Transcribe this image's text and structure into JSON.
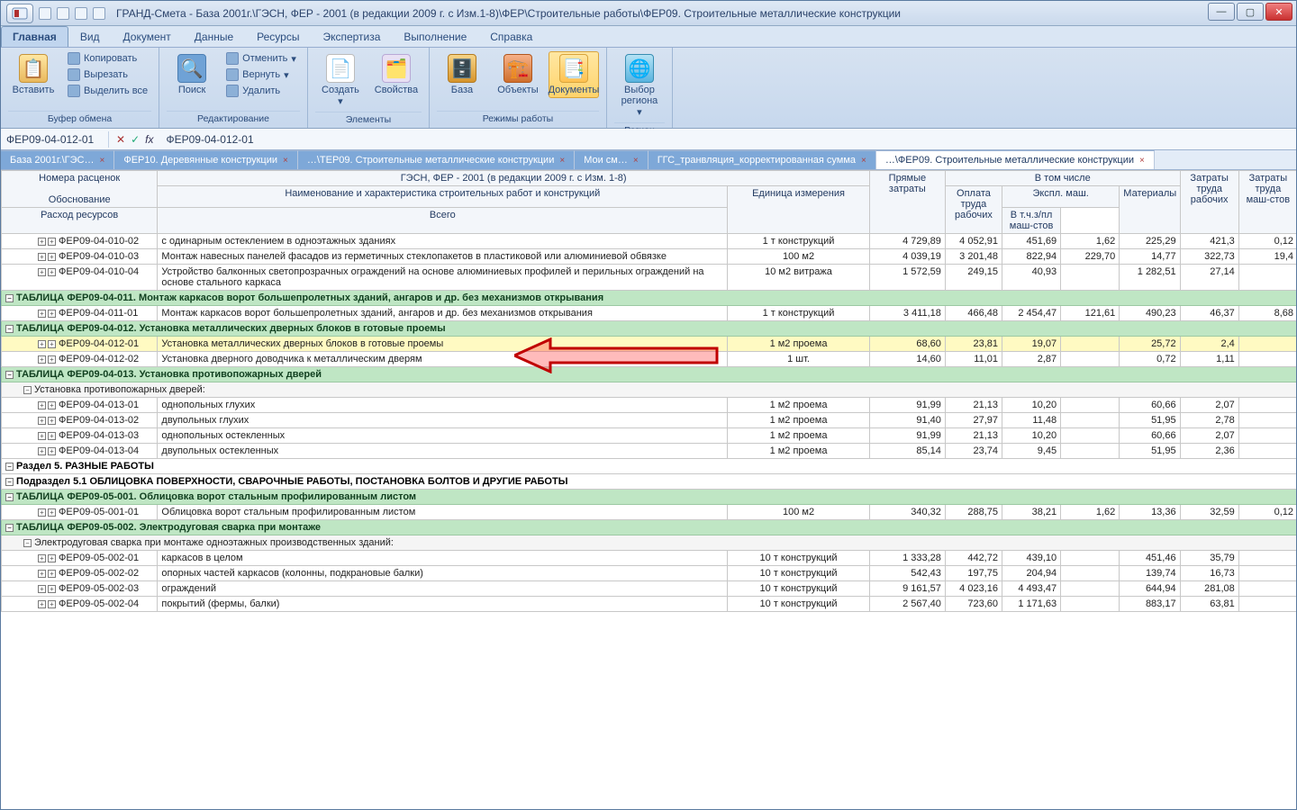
{
  "title": "ГРАНД-Смета - База 2001г.\\ГЭСН, ФЕР - 2001 (в редакции 2009 г. с Изм.1-8)\\ФЕР\\Строительные работы\\ФЕР09. Строительные металлические конструкции",
  "ribbon_tabs": [
    "Главная",
    "Вид",
    "Документ",
    "Данные",
    "Ресурсы",
    "Экспертиза",
    "Выполнение",
    "Справка"
  ],
  "active_ribbon_tab": 0,
  "ribbon": {
    "clipboard": {
      "paste": "Вставить",
      "copy": "Копировать",
      "cut": "Вырезать",
      "selectall": "Выделить все",
      "label": "Буфер обмена"
    },
    "editing": {
      "search": "Поиск",
      "undo": "Отменить",
      "redo": "Вернуть",
      "delete": "Удалить",
      "label": "Редактирование"
    },
    "elements": {
      "create": "Создать",
      "properties": "Свойства",
      "label": "Элементы"
    },
    "modes": {
      "base": "База",
      "objects": "Объекты",
      "documents": "Документы",
      "label": "Режимы работы"
    },
    "region": {
      "choose": "Выбор региона",
      "label": "Регион"
    }
  },
  "formula": {
    "cellref": "ФЕР09-04-012-01",
    "value": "ФЕР09-04-012-01"
  },
  "doctabs": [
    {
      "label": "База 2001г.\\ГЭС…",
      "blue": true
    },
    {
      "label": "ФЕР10. Деревянные конструкции",
      "blue": true
    },
    {
      "label": "…\\ТЕР09. Строительные металлические конструкции",
      "blue": true
    },
    {
      "label": "Мои см…",
      "blue": true
    },
    {
      "label": "ГГС_транвляция_корректированная сумма",
      "blue": true
    },
    {
      "label": "…\\ФЕР09. Строительные металлические конструкции",
      "blue": false,
      "active": true
    }
  ],
  "columns": {
    "nomera": "Номера расценок",
    "obosn": "Обоснование",
    "naimen": "Наименование и характеристика строительных работ и конструкций",
    "raskhod": "Расход ресурсов",
    "group_naimen_top": "ГЭСН, ФЕР - 2001 (в редакции 2009 г. с Изм. 1-8)",
    "edizm": "Единица измерения",
    "pryam": "Прямые затраты",
    "vtom": "В том числе",
    "oplata": "Оплата труда рабочих",
    "ekspl": "Экспл. маш.",
    "vsego": "Всего",
    "vtch": "В т.ч.з/пл маш-стов",
    "mater": "Материалы",
    "zatr_rab": "Затраты труда рабочих",
    "zatr_mash": "Затраты труда маш-стов"
  },
  "rows": [
    {
      "type": "data",
      "code": "ФЕР09-04-010-02",
      "desc": "с одинарным остеклением в одноэтажных зданиях",
      "unit": "1 т конструкций",
      "d": [
        "4 729,89",
        "4 052,91",
        "451,69",
        "1,62",
        "225,29",
        "421,3",
        "0,12"
      ]
    },
    {
      "type": "data",
      "code": "ФЕР09-04-010-03",
      "desc": "Монтаж навесных панелей фасадов из герметичных стеклопакетов в пластиковой или алюминиевой обвязке",
      "unit": "100 м2",
      "d": [
        "4 039,19",
        "3 201,48",
        "822,94",
        "229,70",
        "14,77",
        "322,73",
        "19,4"
      ]
    },
    {
      "type": "data",
      "code": "ФЕР09-04-010-04",
      "desc": "Устройство балконных светопрозрачных ограждений на основе алюминиевых профилей и перильных ограждений на основе стального каркаса",
      "unit": "10 м2 витража",
      "d": [
        "1 572,59",
        "249,15",
        "40,93",
        "",
        "1 282,51",
        "27,14",
        ""
      ]
    },
    {
      "type": "section",
      "title": "ТАБЛИЦА ФЕР09-04-011. Монтаж каркасов ворот большепролетных зданий, ангаров и др. без механизмов открывания"
    },
    {
      "type": "data",
      "code": "ФЕР09-04-011-01",
      "desc": "Монтаж каркасов ворот большепролетных зданий, ангаров и др. без механизмов открывания",
      "unit": "1 т конструкций",
      "d": [
        "3 411,18",
        "466,48",
        "2 454,47",
        "121,61",
        "490,23",
        "46,37",
        "8,68"
      ]
    },
    {
      "type": "section",
      "title": "ТАБЛИЦА ФЕР09-04-012. Установка металлических дверных блоков в готовые проемы"
    },
    {
      "type": "selected",
      "code": "ФЕР09-04-012-01",
      "desc": "Установка металлических дверных блоков в готовые проемы",
      "unit": "1 м2 проема",
      "d": [
        "68,60",
        "23,81",
        "19,07",
        "",
        "25,72",
        "2,4",
        ""
      ]
    },
    {
      "type": "data",
      "code": "ФЕР09-04-012-02",
      "desc": "Установка дверного доводчика к металлическим дверям",
      "unit": "1 шт.",
      "d": [
        "14,60",
        "11,01",
        "2,87",
        "",
        "0,72",
        "1,11",
        ""
      ]
    },
    {
      "type": "section",
      "title": "ТАБЛИЦА ФЕР09-04-013. Установка противопожарных дверей"
    },
    {
      "type": "sub",
      "title": "Установка противопожарных дверей:"
    },
    {
      "type": "data",
      "code": "ФЕР09-04-013-01",
      "desc": "однопольных глухих",
      "unit": "1 м2 проема",
      "d": [
        "91,99",
        "21,13",
        "10,20",
        "",
        "60,66",
        "2,07",
        ""
      ]
    },
    {
      "type": "data",
      "code": "ФЕР09-04-013-02",
      "desc": "двупольных глухих",
      "unit": "1 м2 проема",
      "d": [
        "91,40",
        "27,97",
        "11,48",
        "",
        "51,95",
        "2,78",
        ""
      ]
    },
    {
      "type": "data",
      "code": "ФЕР09-04-013-03",
      "desc": "однопольных остекленных",
      "unit": "1 м2 проема",
      "d": [
        "91,99",
        "21,13",
        "10,20",
        "",
        "60,66",
        "2,07",
        ""
      ]
    },
    {
      "type": "data",
      "code": "ФЕР09-04-013-04",
      "desc": "двупольных остекленных",
      "unit": "1 м2 проема",
      "d": [
        "85,14",
        "23,74",
        "9,45",
        "",
        "51,95",
        "2,36",
        ""
      ]
    },
    {
      "type": "razdel",
      "title": "Раздел 5. РАЗНЫЕ РАБОТЫ"
    },
    {
      "type": "razdel",
      "title": "Подраздел 5.1 ОБЛИЦОВКА ПОВЕРХНОСТИ, СВАРОЧНЫЕ РАБОТЫ, ПОСТАНОВКА БОЛТОВ И ДРУГИЕ РАБОТЫ"
    },
    {
      "type": "section",
      "title": "ТАБЛИЦА ФЕР09-05-001. Облицовка ворот стальным профилированным листом"
    },
    {
      "type": "data",
      "code": "ФЕР09-05-001-01",
      "desc": "Облицовка ворот стальным профилированным листом",
      "unit": "100 м2",
      "d": [
        "340,32",
        "288,75",
        "38,21",
        "1,62",
        "13,36",
        "32,59",
        "0,12"
      ]
    },
    {
      "type": "section",
      "title": "ТАБЛИЦА ФЕР09-05-002. Электродуговая сварка при монтаже"
    },
    {
      "type": "sub",
      "title": "Электродуговая сварка при монтаже одноэтажных производственных зданий:"
    },
    {
      "type": "data",
      "code": "ФЕР09-05-002-01",
      "desc": "каркасов в целом",
      "unit": "10 т конструкций",
      "d": [
        "1 333,28",
        "442,72",
        "439,10",
        "",
        "451,46",
        "35,79",
        ""
      ]
    },
    {
      "type": "data",
      "code": "ФЕР09-05-002-02",
      "desc": "опорных частей каркасов (колонны, подкрановые балки)",
      "unit": "10 т конструкций",
      "d": [
        "542,43",
        "197,75",
        "204,94",
        "",
        "139,74",
        "16,73",
        ""
      ]
    },
    {
      "type": "data",
      "code": "ФЕР09-05-002-03",
      "desc": "ограждений",
      "unit": "10 т конструкций",
      "d": [
        "9 161,57",
        "4 023,16",
        "4 493,47",
        "",
        "644,94",
        "281,08",
        ""
      ]
    },
    {
      "type": "data",
      "code": "ФЕР09-05-002-04",
      "desc": "покрытий (фермы, балки)",
      "unit": "10 т конструкций",
      "d": [
        "2 567,40",
        "723,60",
        "1 171,63",
        "",
        "883,17",
        "63,81",
        ""
      ]
    }
  ]
}
